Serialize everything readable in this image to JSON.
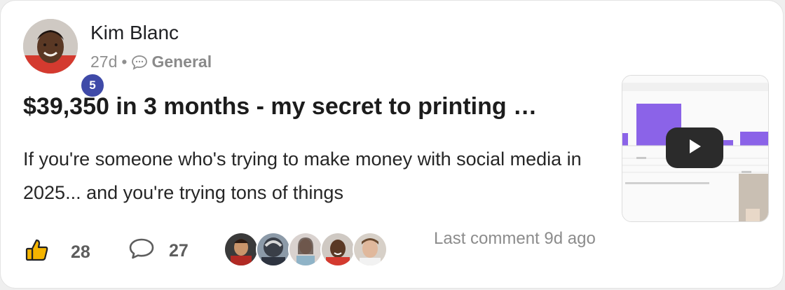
{
  "post": {
    "author": "Kim Blanc",
    "level": "5",
    "age": "27d",
    "separator": "•",
    "category": "General",
    "title": "$39,350 in 3 months - my secret to printing …",
    "excerpt": "If you're someone who's trying to make money with social media in 2025... and you're trying tons of things",
    "likes": "28",
    "comments": "27",
    "last_comment": "Last comment 9d ago"
  },
  "icons": {
    "like": "thumbs-up-icon",
    "comment": "speech-bubble-icon",
    "category": "chat-bubble-icon",
    "play": "play-icon"
  },
  "colors": {
    "level_badge": "#3f4aa8",
    "accent_purple": "#8b63e8",
    "like_icon": "#e8a317"
  }
}
